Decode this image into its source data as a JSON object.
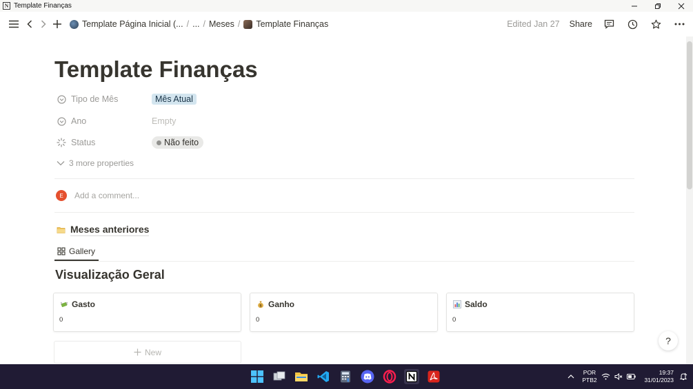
{
  "window": {
    "title": "Template Finanças",
    "app_icon_letter": "N"
  },
  "topbar": {
    "breadcrumbs": [
      "Template Página Inicial (...",
      "...",
      "Meses",
      "Template Finanças"
    ],
    "edited": "Edited Jan 27",
    "share_label": "Share"
  },
  "page": {
    "title": "Template Finanças",
    "properties": [
      {
        "name": "Tipo de Mês",
        "value": "Mês Atual",
        "kind": "select",
        "icon": "chevron-circle-icon"
      },
      {
        "name": "Ano",
        "value": "Empty",
        "kind": "empty",
        "icon": "chevron-circle-icon"
      },
      {
        "name": "Status",
        "value": "Não feito",
        "kind": "status",
        "icon": "loading-spinner-icon"
      }
    ],
    "more_properties": "3 more properties",
    "comment_avatar": "E",
    "comment_placeholder": "Add a comment...",
    "database_title": "Meses anteriores",
    "view_tab": "Gallery",
    "section_heading": "Visualização Geral",
    "cards": [
      {
        "title": "Gasto",
        "value": "0",
        "icon": "money-with-wings-icon"
      },
      {
        "title": "Ganho",
        "value": "0",
        "icon": "money-bag-icon"
      },
      {
        "title": "Saldo",
        "value": "0",
        "icon": "bar-chart-icon"
      }
    ],
    "new_label": "New",
    "help_label": "?"
  },
  "taskbar": {
    "lang_line1": "POR",
    "lang_line2": "PTB2",
    "time": "19:37",
    "date": "31/01/2023"
  },
  "colors": {
    "text": "#37352f",
    "muted": "#9b9a97",
    "select_tag_bg": "#d3e5ef",
    "status_pill_bg": "#e9e9e7",
    "avatar": "#e5502e",
    "taskbar": "#201b34"
  }
}
